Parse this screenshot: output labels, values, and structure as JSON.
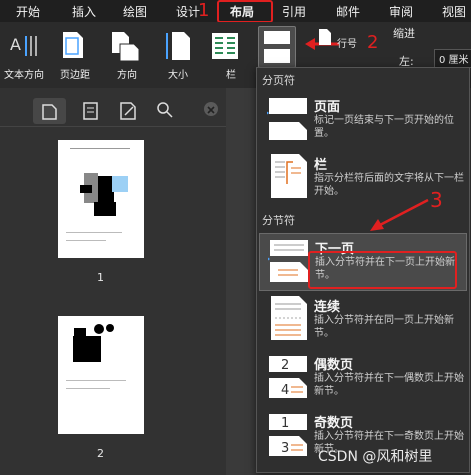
{
  "tabs": [
    "开始",
    "插入",
    "绘图",
    "设计",
    "布局",
    "引用",
    "邮件",
    "审阅",
    "视图"
  ],
  "ribbon": {
    "text_direction": "文本方向",
    "margins": "页边距",
    "orientation": "方向",
    "size": "大小",
    "columns": "栏",
    "line_numbers": "行号",
    "indent": "缩进",
    "left_label": "左:",
    "left_value": "0 厘米"
  },
  "sidebar": {
    "page1": "1",
    "page2": "2"
  },
  "menu": {
    "page_breaks_header": "分页符",
    "section_breaks_header": "分节符",
    "items": [
      {
        "title": "页面",
        "desc": "标记一页结束与下一页开始的位置。"
      },
      {
        "title": "栏",
        "desc": "指示分栏符后面的文字将从下一栏开始。"
      },
      {
        "title": "下一页",
        "desc": "插入分节符并在下一页上开始新节。"
      },
      {
        "title": "连续",
        "desc": "插入分节符并在同一页上开始新节。"
      },
      {
        "title": "偶数页",
        "desc": "插入分节符并在下一偶数页上开始新节。"
      },
      {
        "title": "奇数页",
        "desc": "插入分节符并在下一奇数页上开始新节。"
      }
    ]
  },
  "annotations": {
    "n1": "1",
    "n2": "2",
    "n3": "3"
  },
  "watermark": "CSDN @风和树里"
}
